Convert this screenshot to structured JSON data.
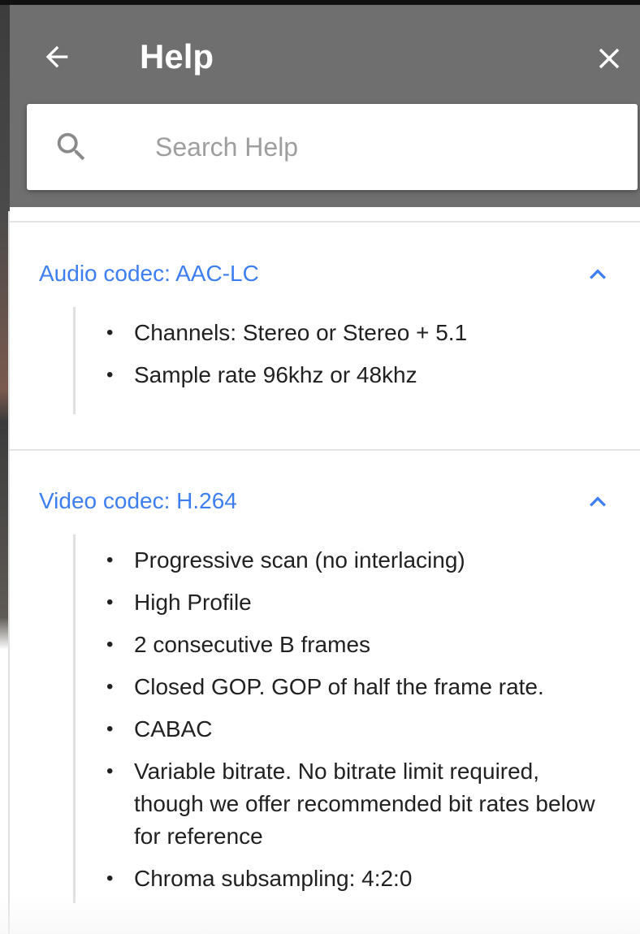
{
  "header": {
    "title": "Help"
  },
  "search": {
    "placeholder": "Search Help",
    "value": ""
  },
  "sections": [
    {
      "title": "Audio codec: AAC-LC",
      "expanded": true,
      "items": [
        "Channels: Stereo or Stereo + 5.1",
        "Sample rate 96khz or 48khz"
      ]
    },
    {
      "title": "Video codec: H.264",
      "expanded": true,
      "items": [
        "Progressive scan (no interlacing)",
        "High Profile",
        "2 consecutive B frames",
        "Closed GOP. GOP of half the frame rate.",
        "CABAC",
        "Variable bitrate. No bitrate limit required, though we offer recommended bit rates below for reference",
        "Chroma subsampling: 4:2:0"
      ]
    }
  ],
  "colors": {
    "header_bg": "#6f6f6f",
    "link_blue": "#3d7ef0",
    "text": "#212121",
    "placeholder": "#9e9e9e"
  },
  "icons": {
    "back": "arrow-left-icon",
    "close": "close-icon",
    "search": "search-icon",
    "collapse": "chevron-up-icon"
  }
}
